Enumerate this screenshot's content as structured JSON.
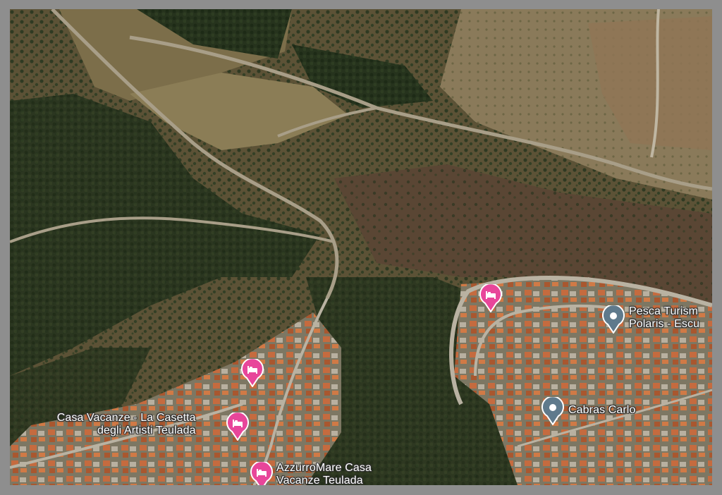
{
  "map": {
    "view": "satellite",
    "places": [
      {
        "id": "casa-vacanze-la-casetta",
        "name": "Casa Vacanze - La Casetta degli Artisti Teulada",
        "line1": "Casa Vacanze - La Casetta",
        "line2": "degli Artisti Teulada",
        "category": "lodging",
        "icon": "bed-icon",
        "color": "#e8469a"
      },
      {
        "id": "azzurromare",
        "name": "AzzurroMare Casa Vacanze Teulada",
        "line1": "AzzurroMare Casa",
        "line2": "Vacanze Teulada",
        "category": "lodging",
        "icon": "bed-icon",
        "color": "#e8469a"
      },
      {
        "id": "pesca-turismo",
        "name": "Pesca Turismo Polaris - Escu",
        "line1": "Pesca Turism",
        "line2": "Polaris - Escu",
        "category": "place",
        "icon": "location-icon",
        "color": "#5f7a8c"
      },
      {
        "id": "cabras-carlo",
        "name": "Cabras Carlo",
        "line1": "Cabras Carlo",
        "line2": "",
        "category": "place",
        "icon": "location-icon",
        "color": "#5f7a8c"
      }
    ],
    "unlabeled_pins": [
      {
        "id": "lodging-pin-a",
        "category": "lodging",
        "icon": "bed-icon",
        "color": "#e8469a"
      },
      {
        "id": "lodging-pin-b",
        "category": "lodging",
        "icon": "bed-icon",
        "color": "#e8469a"
      }
    ]
  }
}
